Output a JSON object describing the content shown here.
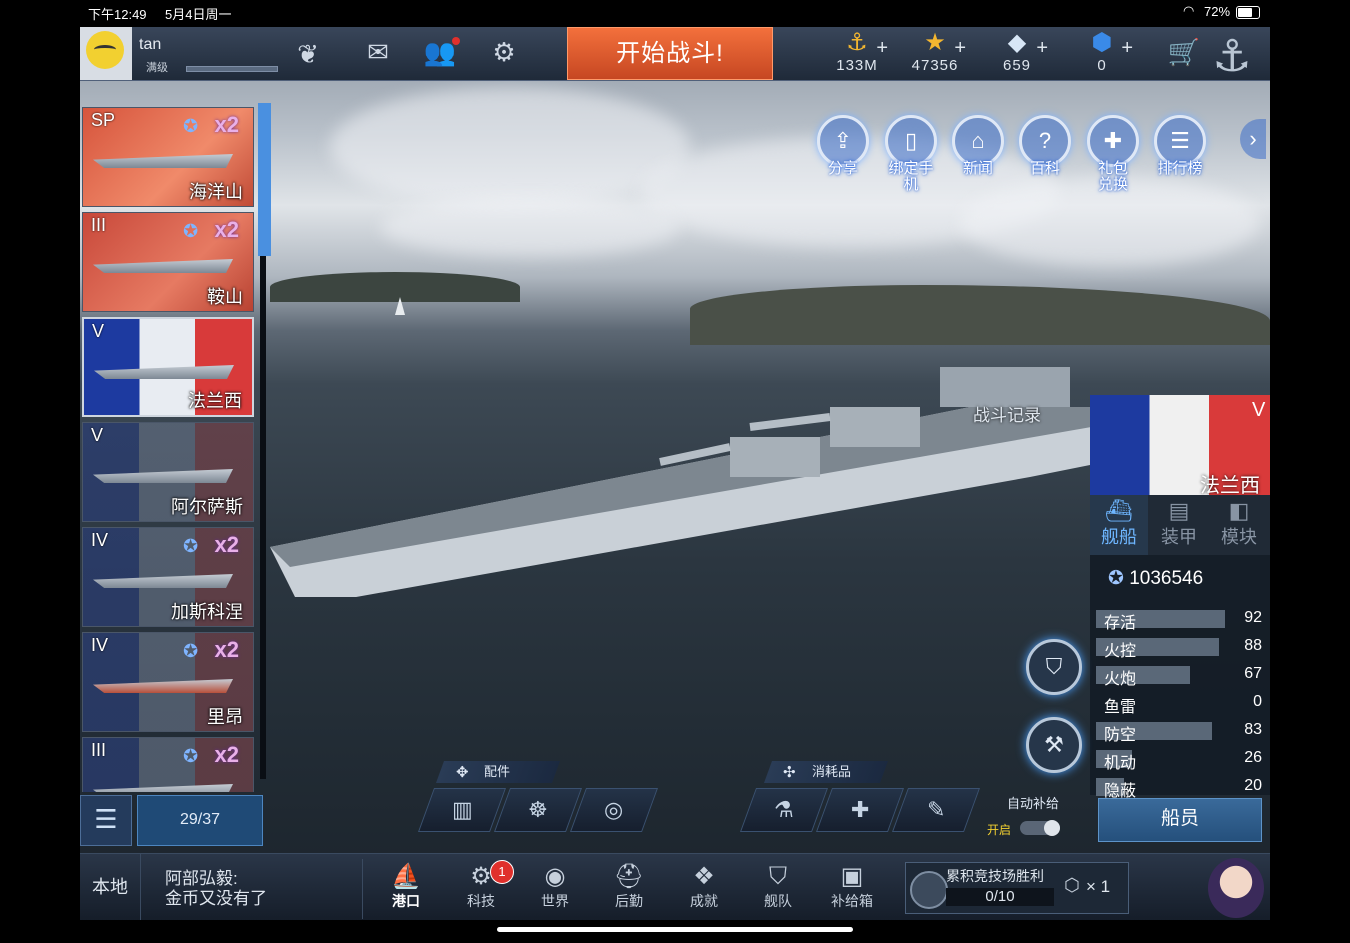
{
  "status_bar": {
    "time": "下午12:49",
    "date": "5月4日周一",
    "battery": "72%"
  },
  "player": {
    "name": "tan",
    "level": "满级"
  },
  "top_bar": {
    "battle_button": "开始战斗!",
    "resources": [
      {
        "icon": "anchor-coin-icon",
        "value": "133M"
      },
      {
        "icon": "star-icon",
        "value": "47356"
      },
      {
        "icon": "diamond-icon",
        "value": "659"
      },
      {
        "icon": "gem-icon",
        "value": "0"
      }
    ]
  },
  "quick_menu": [
    {
      "icon": "share-icon",
      "label": "分享"
    },
    {
      "icon": "phone-icon",
      "label": "绑定手机"
    },
    {
      "icon": "news-icon",
      "label": "新闻"
    },
    {
      "icon": "wiki-icon",
      "label": "百科"
    },
    {
      "icon": "gift-icon",
      "label": "礼包兑换"
    },
    {
      "icon": "ranking-icon",
      "label": "排行榜"
    }
  ],
  "ship_list": {
    "items": [
      {
        "tier": "SP",
        "name": "海洋山",
        "multiplier": "x2",
        "flag": "cn"
      },
      {
        "tier": "III",
        "name": "鞍山",
        "multiplier": "x2",
        "flag": "cn"
      },
      {
        "tier": "V",
        "name": "法兰西",
        "multiplier": "",
        "flag": "fr",
        "selected": true
      },
      {
        "tier": "V",
        "name": "阿尔萨斯",
        "multiplier": "",
        "flag": "fr"
      },
      {
        "tier": "IV",
        "name": "加斯科涅",
        "multiplier": "x2",
        "flag": "fr"
      },
      {
        "tier": "IV",
        "name": "里昂",
        "multiplier": "x2",
        "flag": "fr"
      },
      {
        "tier": "III",
        "name": "",
        "multiplier": "x2",
        "flag": "fr"
      }
    ],
    "count": "29/37"
  },
  "battle_record_label": "战斗记录",
  "selected_ship": {
    "tier": "V",
    "name": "法兰西",
    "tabs": [
      {
        "icon": "ship-icon",
        "label": "舰船",
        "active": true
      },
      {
        "icon": "armor-icon",
        "label": "装甲",
        "active": false
      },
      {
        "icon": "module-icon",
        "label": "模块",
        "active": false
      }
    ],
    "power": "1036546",
    "stats": [
      {
        "label": "存活",
        "value": 92
      },
      {
        "label": "火控",
        "value": 88
      },
      {
        "label": "火炮",
        "value": 67
      },
      {
        "label": "鱼雷",
        "value": 0
      },
      {
        "label": "防空",
        "value": 83
      },
      {
        "label": "机动",
        "value": 26
      },
      {
        "label": "隐蔽",
        "value": 20
      }
    ],
    "crew_button": "船员"
  },
  "parts_label": "配件",
  "consumables_label": "消耗品",
  "auto_supply": {
    "label": "自动补给",
    "state": "开启"
  },
  "chat": {
    "channel": "本地",
    "sender": "阿部弘毅:",
    "message": "金币又没有了"
  },
  "nav": [
    {
      "icon": "harbor-icon",
      "label": "港口",
      "active": true
    },
    {
      "icon": "tech-icon",
      "label": "科技",
      "badge": "1"
    },
    {
      "icon": "world-icon",
      "label": "世界"
    },
    {
      "icon": "logistics-icon",
      "label": "后勤"
    },
    {
      "icon": "achievement-icon",
      "label": "成就"
    },
    {
      "icon": "fleet-icon",
      "label": "舰队"
    },
    {
      "icon": "supply-box-icon",
      "label": "补给箱"
    }
  ],
  "arena": {
    "title": "累积竞技场胜利",
    "progress": "0/10",
    "reward": "× 1"
  }
}
